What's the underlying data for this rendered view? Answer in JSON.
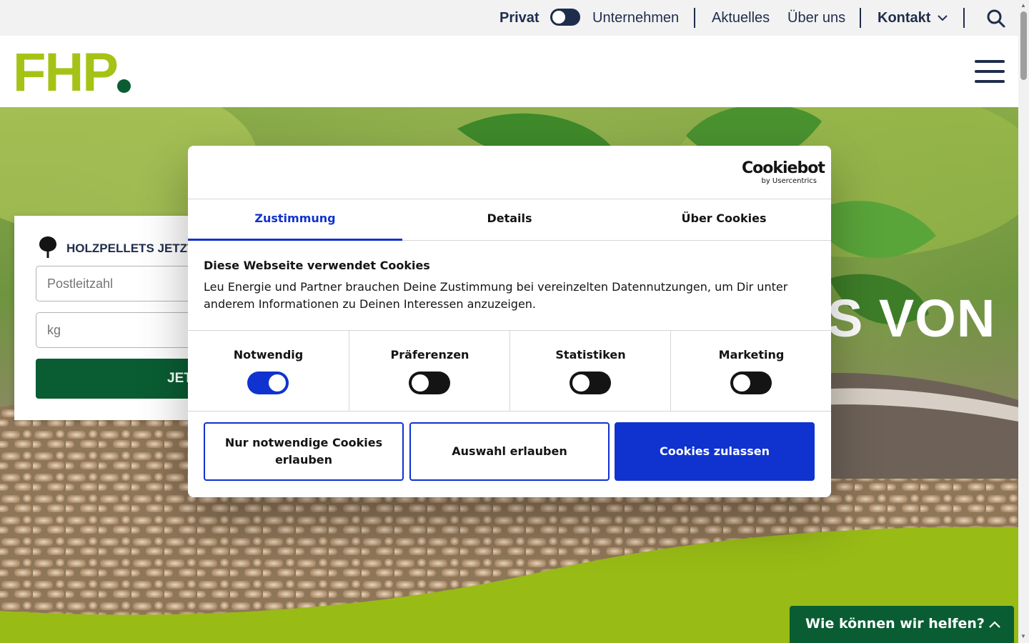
{
  "topbar": {
    "privat": "Privat",
    "unternehmen": "Unternehmen",
    "aktuelles": "Aktuelles",
    "ueber_uns": "Über uns",
    "kontakt": "Kontakt"
  },
  "header": {
    "logo": "FHP"
  },
  "hero": {
    "title_visible": "S VON"
  },
  "order_card": {
    "title": "HOLZPELLETS JETZT",
    "postcode_placeholder": "Postleitzahl",
    "kg_placeholder": "kg",
    "button_label": "JET"
  },
  "cookie_dialog": {
    "brand": "Cookiebot",
    "brand_sub": "by Usercentrics",
    "tabs": [
      "Zustimmung",
      "Details",
      "Über Cookies"
    ],
    "heading": "Diese Webseite verwendet Cookies",
    "text": "Leu Energie und Partner brauchen Deine Zustimmung bei vereinzelten Datennutzungen, um Dir unter anderem Informationen zu Deinen Interessen anzuzeigen.",
    "categories": [
      {
        "label": "Notwendig",
        "enabled": true
      },
      {
        "label": "Präferenzen",
        "enabled": false
      },
      {
        "label": "Statistiken",
        "enabled": false
      },
      {
        "label": "Marketing",
        "enabled": false
      }
    ],
    "buttons": {
      "necessary_only": "Nur notwendige Cookies erlauben",
      "allow_selection": "Auswahl erlauben",
      "allow_all": "Cookies zulassen"
    }
  },
  "help_widget": {
    "label": "Wie können wir helfen?"
  },
  "colors": {
    "navy": "#1f2d4d",
    "brand_green": "#a5c316",
    "dark_green": "#0a5d33",
    "cookie_blue": "#1032cf"
  }
}
